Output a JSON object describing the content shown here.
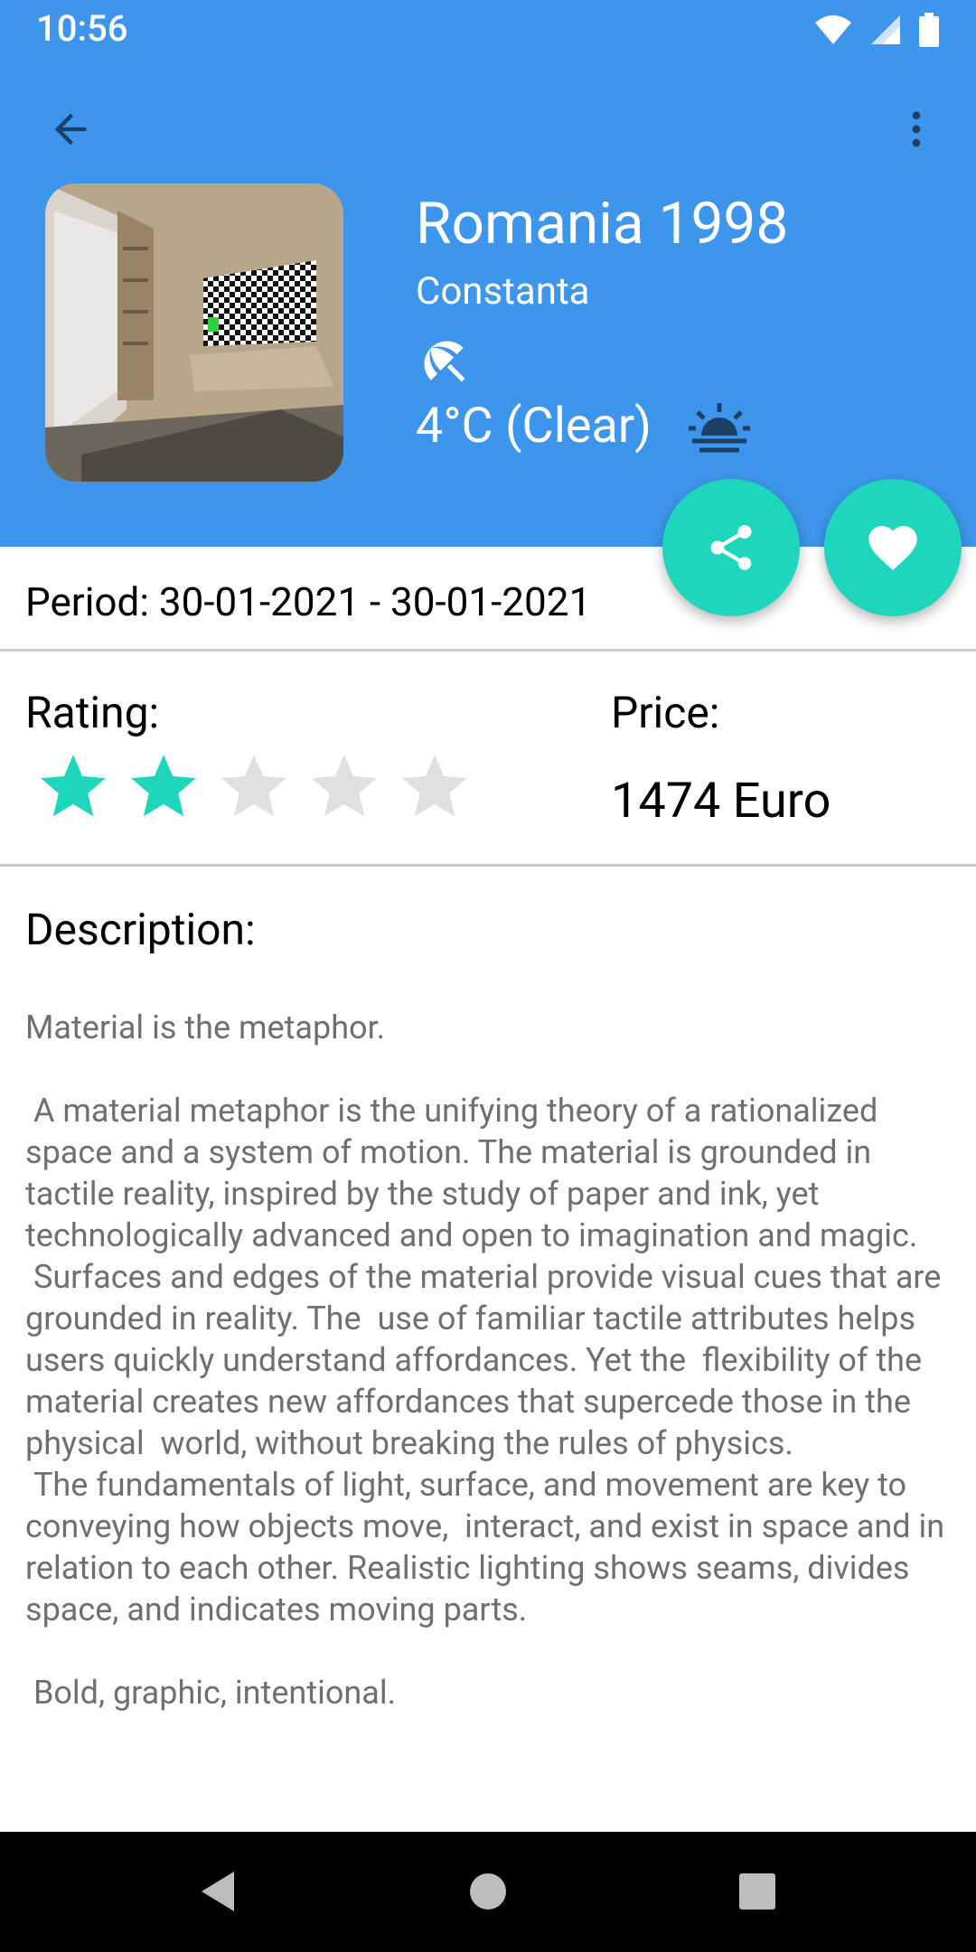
{
  "status_bar": {
    "time": "10:56"
  },
  "header": {
    "title": "Romania 1998",
    "location": "Constanta",
    "weather": "4°C (Clear)"
  },
  "icons": {
    "back": "arrow-back-icon",
    "menu": "more-vert-icon",
    "beach": "beach-umbrella-icon",
    "sunrise": "sunrise-icon",
    "share": "share-icon",
    "favorite": "heart-icon"
  },
  "trip": {
    "period_label": "Period:",
    "period_value": "30-01-2021 - 30-01-2021",
    "rating_label": "Rating:",
    "rating_value": 2,
    "rating_max": 5,
    "price_label": "Price:",
    "price_value": "1474 Euro"
  },
  "description": {
    "label": "Description:",
    "text": "Material is the metaphor.\n\n A material metaphor is the unifying theory of a rationalized space and a system of motion. The material is grounded in tactile reality, inspired by the study of paper and ink, yet technologically advanced and open to imagination and magic.\n Surfaces and edges of the material provide visual cues that are grounded in reality. The  use of familiar tactile attributes helps users quickly understand affordances. Yet the  flexibility of the material creates new affordances that supercede those in the physical  world, without breaking the rules of physics.\n The fundamentals of light, surface, and movement are key to conveying how objects move,  interact, and exist in space and in relation to each other. Realistic lighting shows seams, divides space, and indicates moving parts.\n\n Bold, graphic, intentional."
  },
  "colors": {
    "header_bg": "#3d95ec",
    "accent": "#1ed6bc",
    "star_empty": "#e0e0e0"
  }
}
